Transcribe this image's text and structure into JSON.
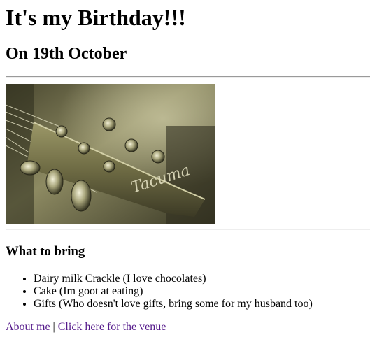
{
  "header": {
    "title": "It's my Birthday!!!",
    "date": "On 19th October"
  },
  "image": {
    "description": "guitar-headstock-icon",
    "brand_text": "Tacuma"
  },
  "bring": {
    "heading": "What to bring",
    "items": [
      "Dairy milk Crackle (I love chocolates)",
      "Cake (Im goot at eating)",
      "Gifts (Who doesn't love gifts, bring some for my husband too)"
    ]
  },
  "links": {
    "about": "About me ",
    "separator": "|",
    "venue": "Click here for the venue"
  },
  "colors": {
    "link_visited": "#551a8b",
    "photo_tint": "#8c8a5a"
  }
}
